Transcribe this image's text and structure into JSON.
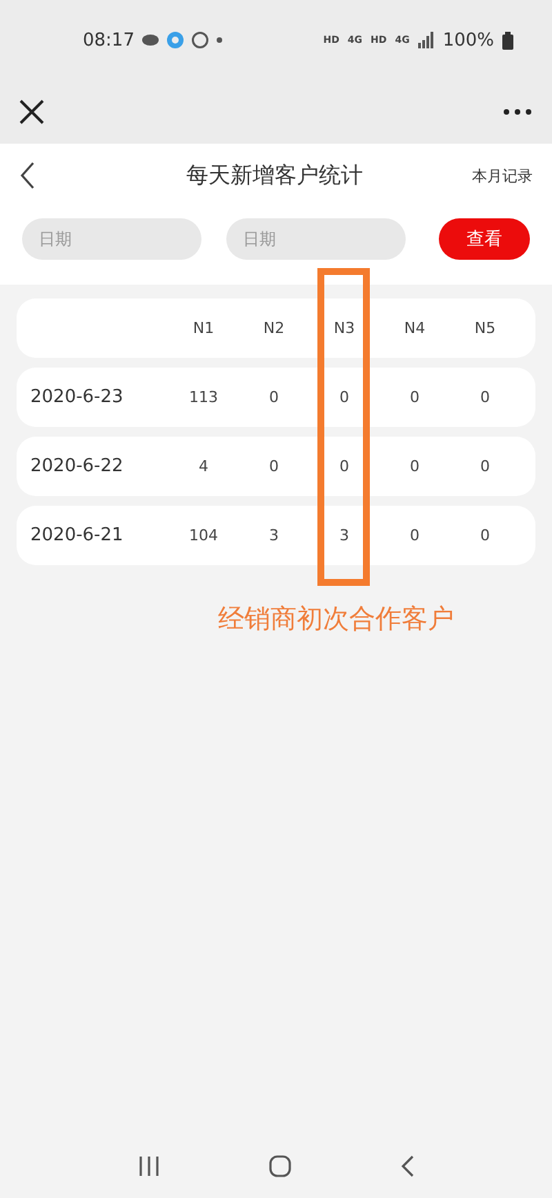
{
  "status_bar": {
    "time": "08:17",
    "network_labels": [
      "HD",
      "4G",
      "HD",
      "4G"
    ],
    "battery": "100%"
  },
  "header": {
    "title": "每天新增客户统计",
    "action": "本月记录"
  },
  "filters": {
    "start": {
      "placeholder": "日期"
    },
    "end": {
      "placeholder": "日期"
    },
    "button": "查看"
  },
  "table": {
    "columns": [
      "N1",
      "N2",
      "N3",
      "N4",
      "N5"
    ],
    "rows": [
      {
        "date": "2020-6-23",
        "values": [
          "113",
          "0",
          "0",
          "0",
          "0"
        ]
      },
      {
        "date": "2020-6-22",
        "values": [
          "4",
          "0",
          "0",
          "0",
          "0"
        ]
      },
      {
        "date": "2020-6-21",
        "values": [
          "104",
          "3",
          "3",
          "0",
          "0"
        ]
      }
    ]
  },
  "annotation": {
    "caption": "经销商初次合作客户"
  }
}
